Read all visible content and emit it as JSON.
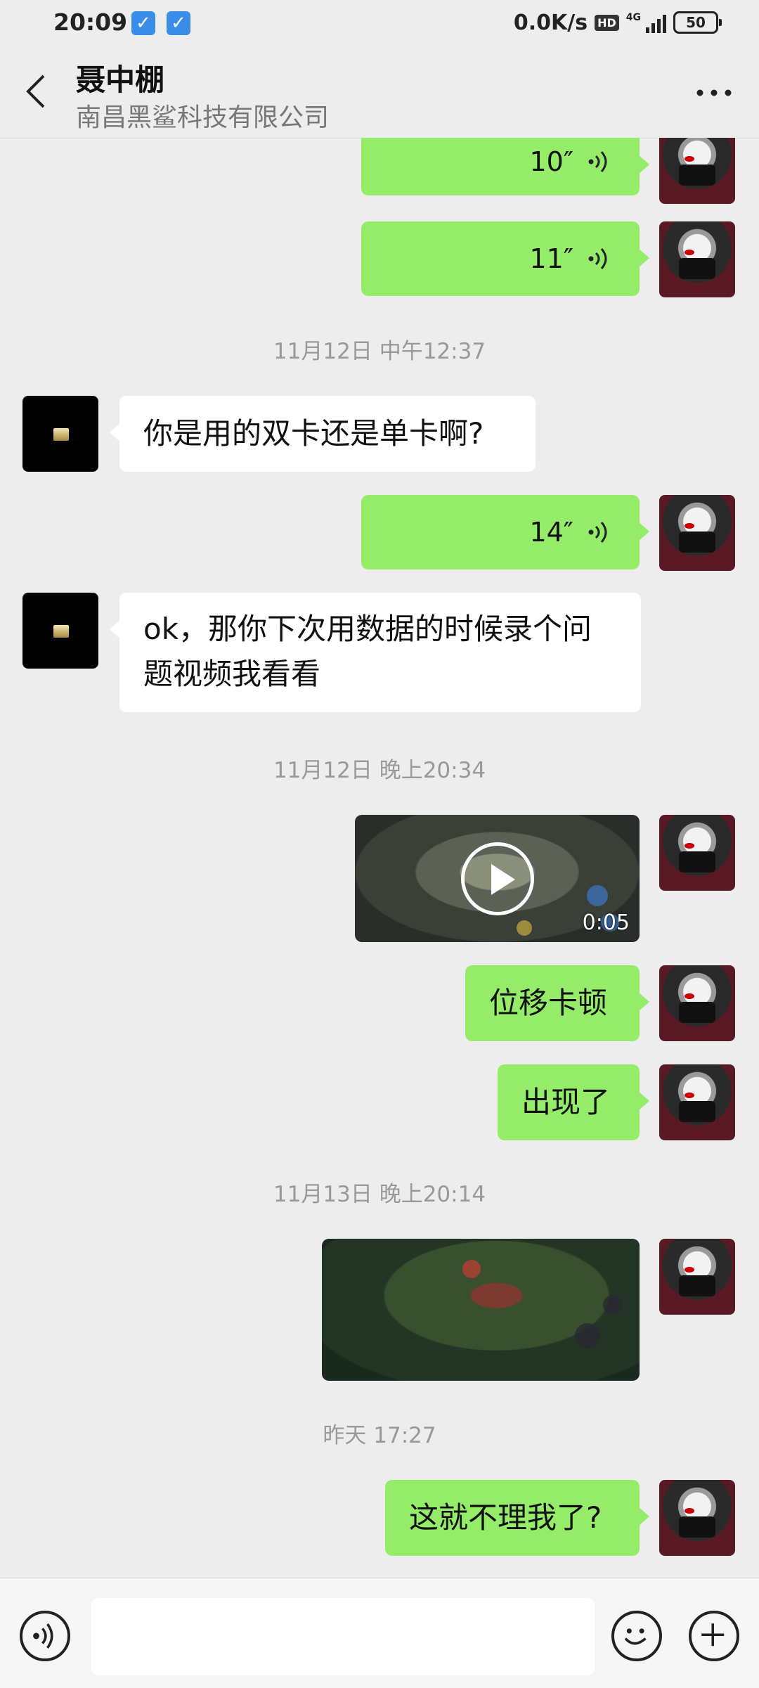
{
  "status_bar": {
    "time": "20:09",
    "net_speed": "0.0K/s",
    "hd": "HD",
    "network": "4G",
    "battery": "50"
  },
  "header": {
    "title": "聂中棚",
    "subtitle": "南昌黑鲨科技有限公司"
  },
  "messages": {
    "voice1": {
      "duration": "10″"
    },
    "voice2": {
      "duration": "11″"
    },
    "ts1": "11月12日 中午12:37",
    "text1": "你是用的双卡还是单卡啊?",
    "voice3": {
      "duration": "14″"
    },
    "text2": "ok，那你下次用数据的时候录个问题视频我看看",
    "ts2": "11月12日 晚上20:34",
    "video1": {
      "duration": "0:05"
    },
    "text3": "位移卡顿",
    "text4": "出现了",
    "ts3": "11月13日 晚上20:14",
    "ts4": "昨天 17:27",
    "text5": "这就不理我了?"
  },
  "icons": {
    "back": "back-arrow-icon",
    "more": "more-dots-icon",
    "voice_toggle": "voice-mode-icon",
    "emoji": "emoji-icon",
    "plus": "plus-icon"
  }
}
